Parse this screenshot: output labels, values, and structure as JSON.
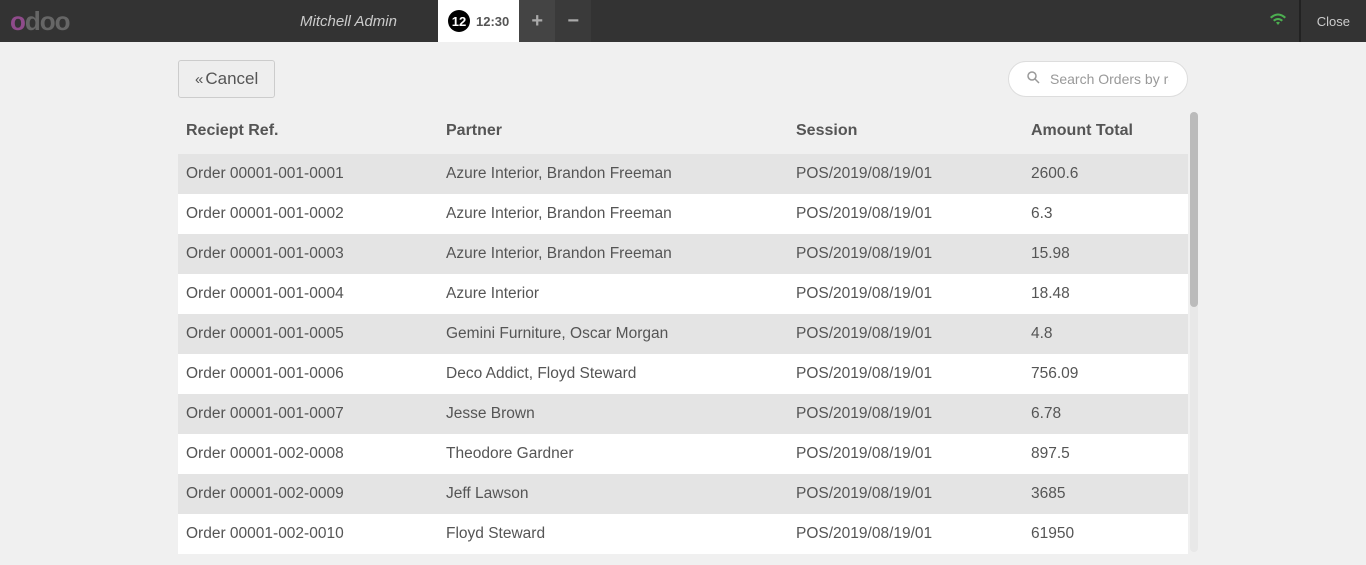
{
  "header": {
    "brand": "odoo",
    "user": "Mitchell Admin",
    "day": "12",
    "time": "12:30",
    "close_label": "Close"
  },
  "toolbar": {
    "cancel_label": "Cancel"
  },
  "search": {
    "placeholder": "Search Orders by ref"
  },
  "table": {
    "headers": {
      "ref": "Reciept Ref.",
      "partner": "Partner",
      "session": "Session",
      "amount": "Amount Total"
    },
    "rows": [
      {
        "ref": "Order 00001-001-0001",
        "partner": "Azure Interior, Brandon Freeman",
        "session": "POS/2019/08/19/01",
        "amount": "2600.6"
      },
      {
        "ref": "Order 00001-001-0002",
        "partner": "Azure Interior, Brandon Freeman",
        "session": "POS/2019/08/19/01",
        "amount": "6.3"
      },
      {
        "ref": "Order 00001-001-0003",
        "partner": "Azure Interior, Brandon Freeman",
        "session": "POS/2019/08/19/01",
        "amount": "15.98"
      },
      {
        "ref": "Order 00001-001-0004",
        "partner": "Azure Interior",
        "session": "POS/2019/08/19/01",
        "amount": "18.48"
      },
      {
        "ref": "Order 00001-001-0005",
        "partner": "Gemini Furniture, Oscar Morgan",
        "session": "POS/2019/08/19/01",
        "amount": "4.8"
      },
      {
        "ref": "Order 00001-001-0006",
        "partner": "Deco Addict, Floyd Steward",
        "session": "POS/2019/08/19/01",
        "amount": "756.09"
      },
      {
        "ref": "Order 00001-001-0007",
        "partner": "Jesse Brown",
        "session": "POS/2019/08/19/01",
        "amount": "6.78"
      },
      {
        "ref": "Order 00001-002-0008",
        "partner": "Theodore Gardner",
        "session": "POS/2019/08/19/01",
        "amount": "897.5"
      },
      {
        "ref": "Order 00001-002-0009",
        "partner": "Jeff Lawson",
        "session": "POS/2019/08/19/01",
        "amount": "3685"
      },
      {
        "ref": "Order 00001-002-0010",
        "partner": "Floyd Steward",
        "session": "POS/2019/08/19/01",
        "amount": "61950"
      }
    ]
  }
}
